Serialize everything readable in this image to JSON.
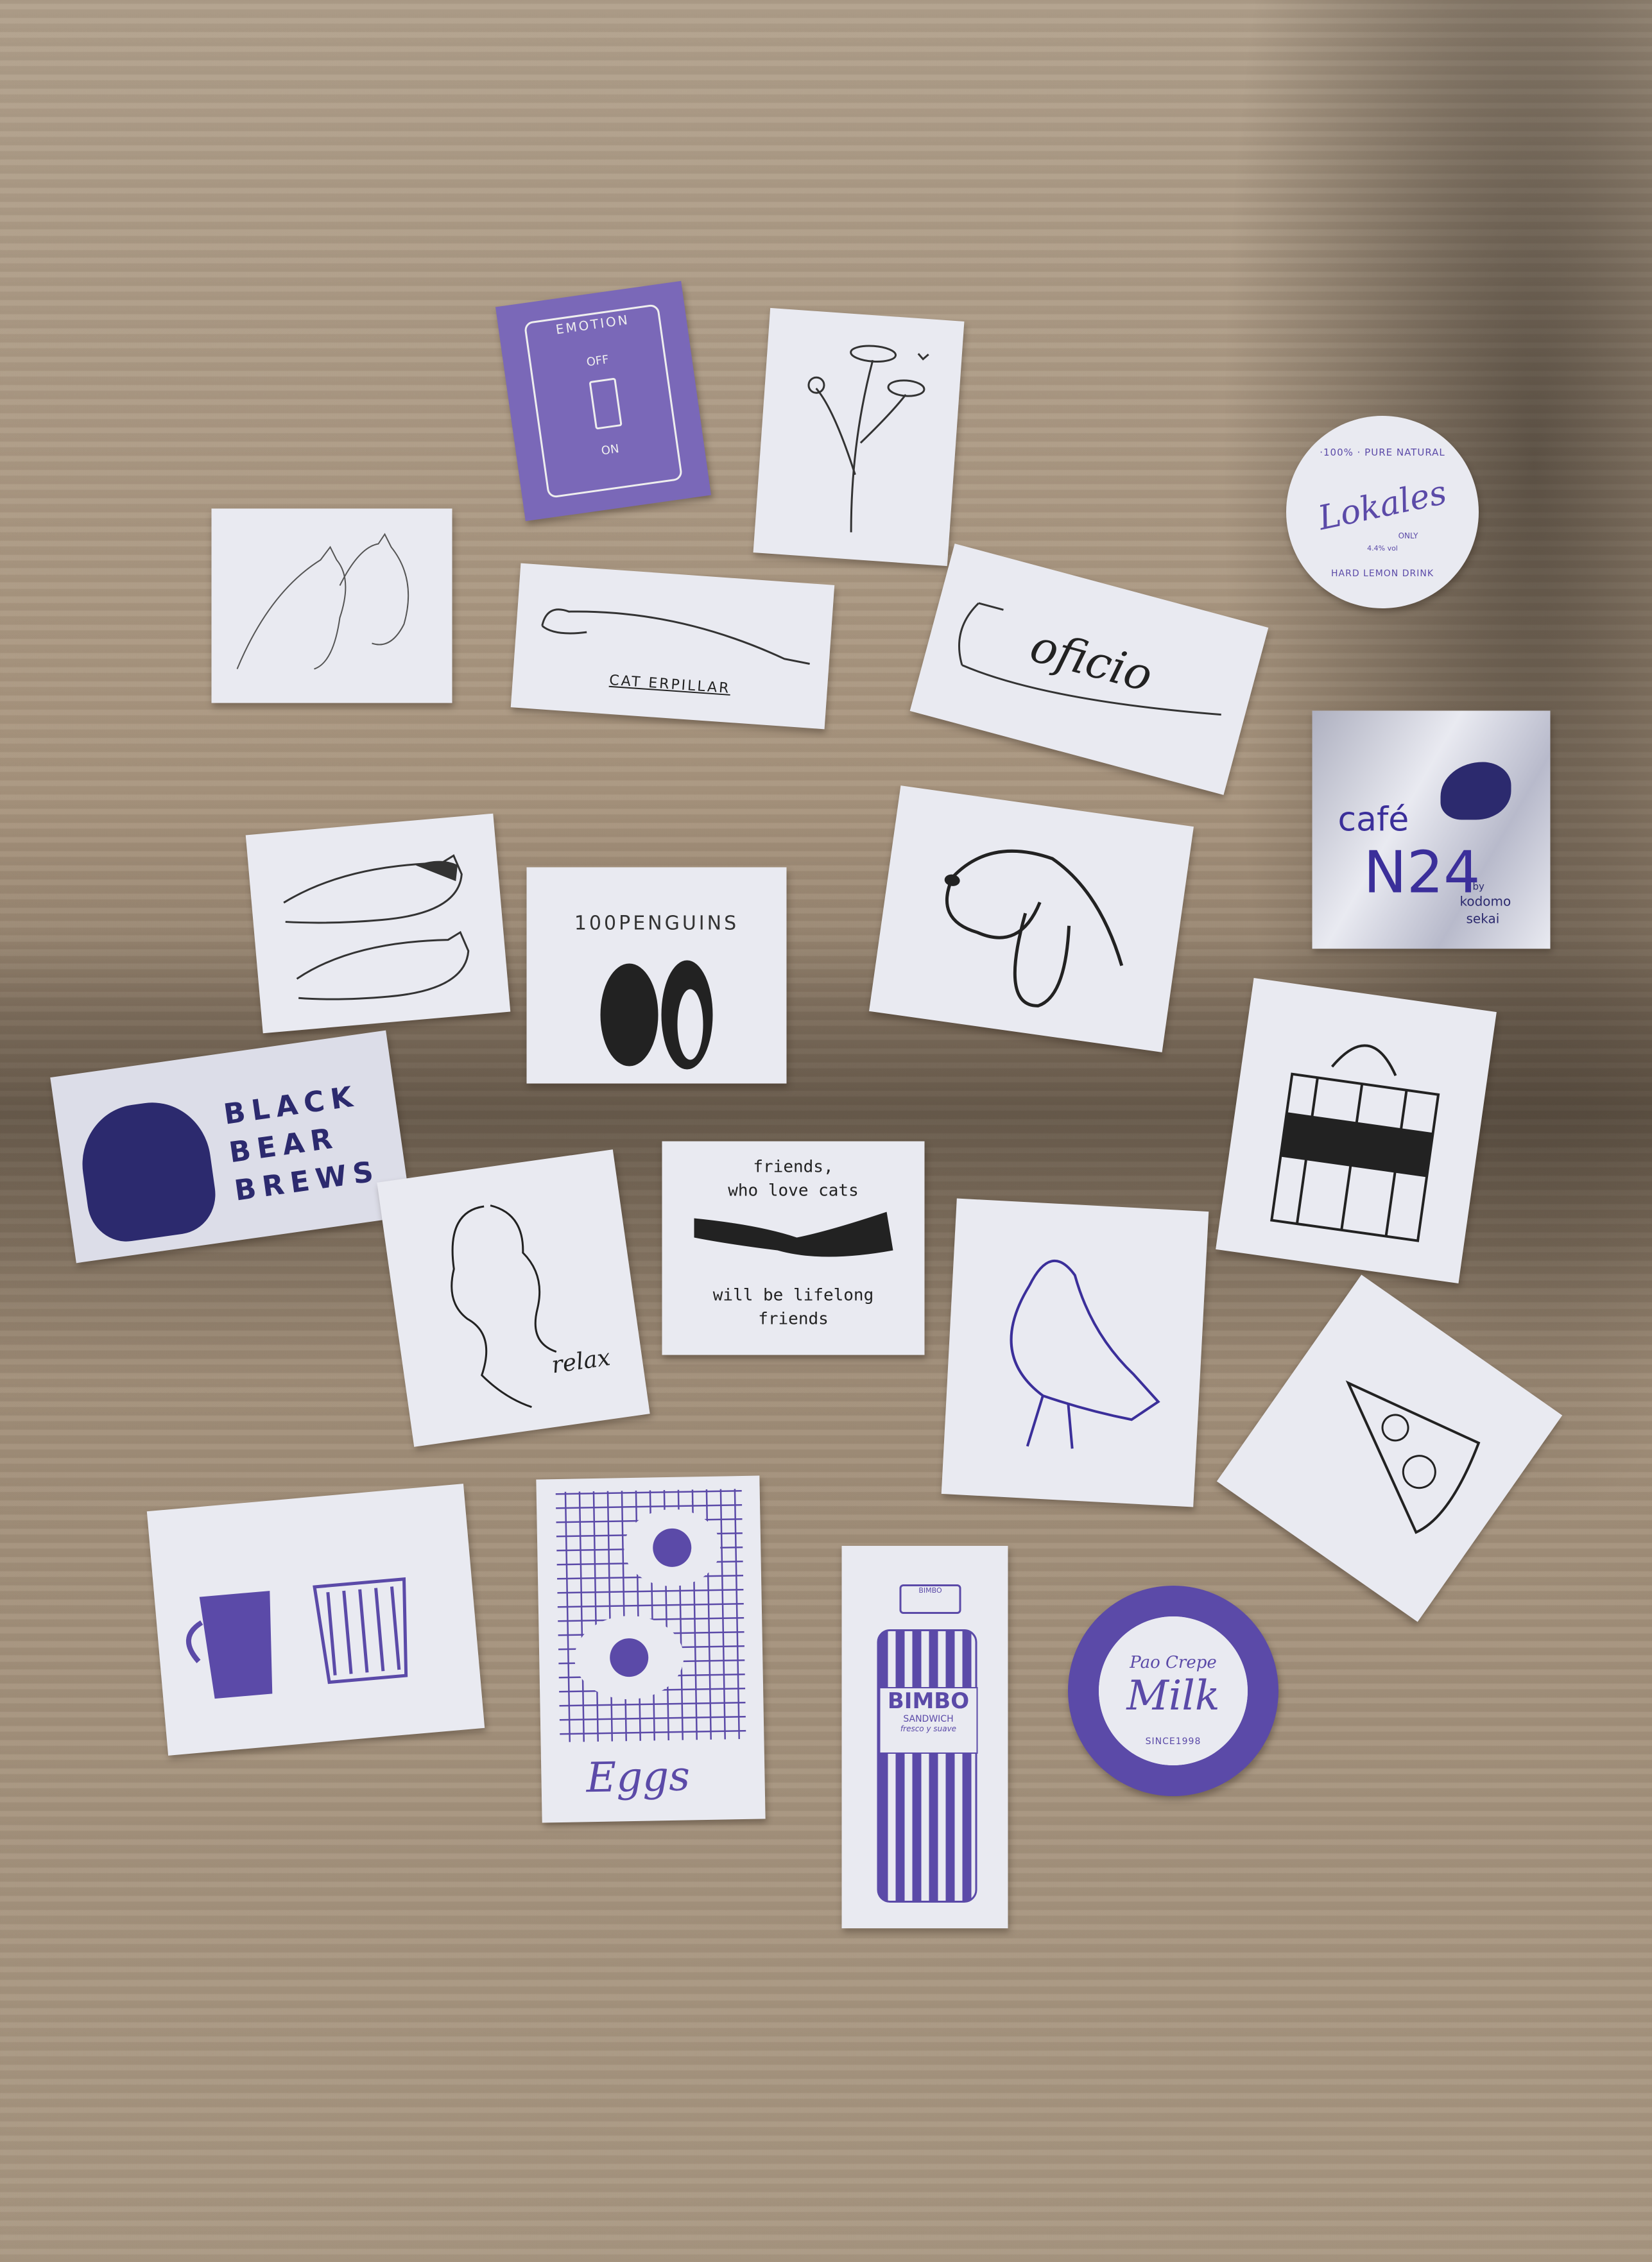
{
  "colors": {
    "wood": "#a8957f",
    "sticker": "#e9eaf1",
    "purple": "#6b5cb3",
    "ink": "#222222",
    "navy": "#2c2a6e"
  },
  "stickers": {
    "switch": {
      "top": "EMOTION",
      "off": "OFF",
      "on": "ON"
    },
    "lokales": {
      "arc_top": "·100% · PURE NATURAL",
      "script": "Lokales",
      "only": "ONLY",
      "volume": "4.4% vol",
      "arc_bottom": "HARD LEMON DRINK"
    },
    "caterpillar": {
      "text": "CAT ERPILLAR"
    },
    "oficio": {
      "text": "oficio"
    },
    "cafe": {
      "cafe": "café",
      "number": "N24",
      "by": "by",
      "maker1": "kodomo",
      "maker2": "sekai"
    },
    "penguins": {
      "text": "100PENGUINS"
    },
    "bear": {
      "line1": "BLACK",
      "line2": "BEAR",
      "line3": "BREWS"
    },
    "relax": {
      "text": "relax"
    },
    "friends": {
      "line1": "friends,",
      "line2": "who love cats",
      "line3": "will be lifelong",
      "line4": "friends"
    },
    "eggs": {
      "text": "Eggs"
    },
    "bimbo": {
      "cap": "BIMBO",
      "brand": "BIMBO",
      "sub": "SANDWICH",
      "script": "fresco y suave"
    },
    "milk": {
      "top": "Pao Crepe",
      "main": "Milk",
      "since": "SINCE1998"
    }
  }
}
